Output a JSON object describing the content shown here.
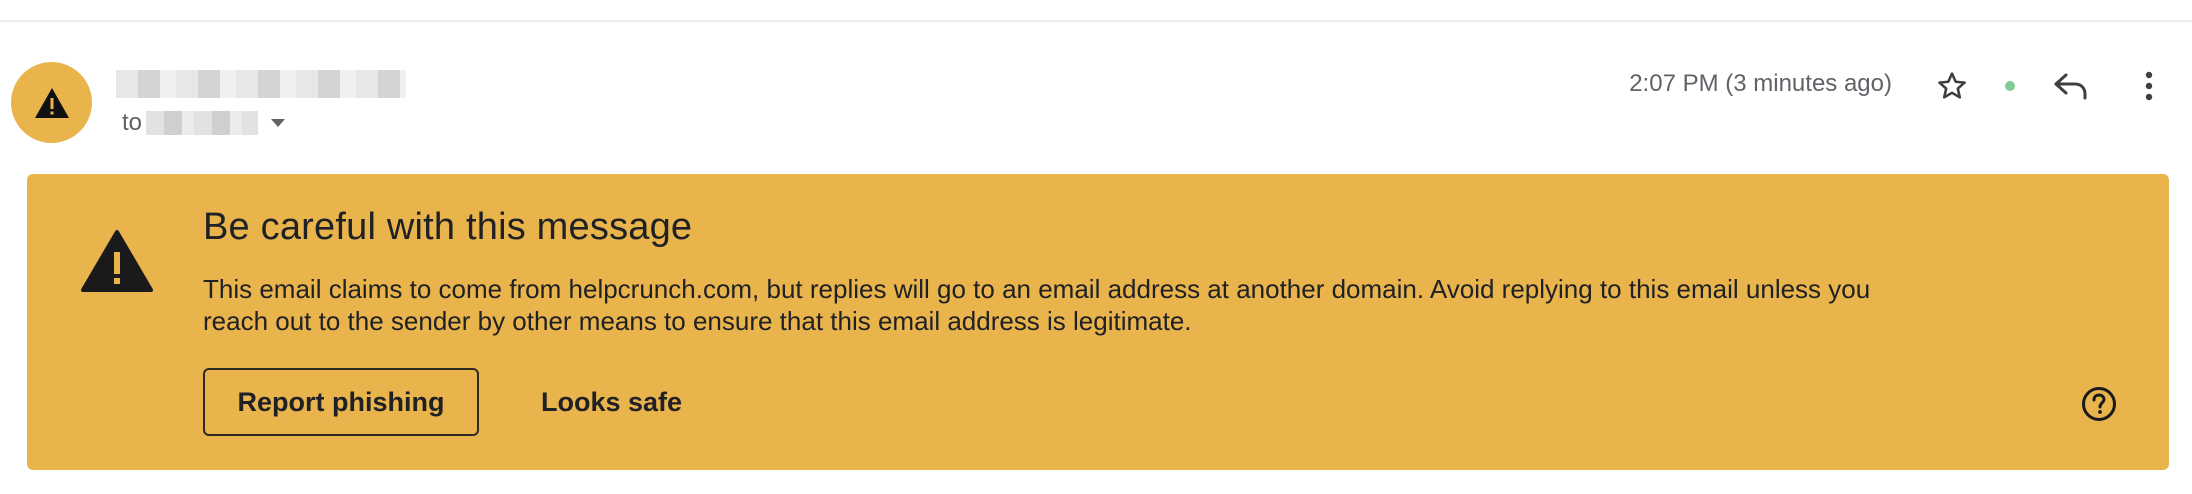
{
  "header": {
    "to_label": "to",
    "timestamp": "2:07 PM (3 minutes ago)",
    "icons": {
      "avatar": "warning-triangle-icon",
      "star": "star-outline-icon",
      "status": "online-dot-icon",
      "reply": "reply-arrow-icon",
      "more": "vertical-dots-icon",
      "chevron": "caret-down-icon"
    }
  },
  "banner": {
    "title": "Be careful with this message",
    "body": "This email claims to come from helpcrunch.com, but replies will go to an email address at another domain. Avoid replying to this email unless you reach out to the sender by other means to ensure that this email address is legitimate.",
    "report_button": "Report phishing",
    "safe_button": "Looks safe",
    "icons": {
      "warning": "warning-triangle-icon",
      "help": "help-circle-icon"
    }
  },
  "colors": {
    "banner_bg": "#e9b44c",
    "online_dot": "#81c995",
    "text": "#202124",
    "secondary_text": "#5f6368"
  }
}
